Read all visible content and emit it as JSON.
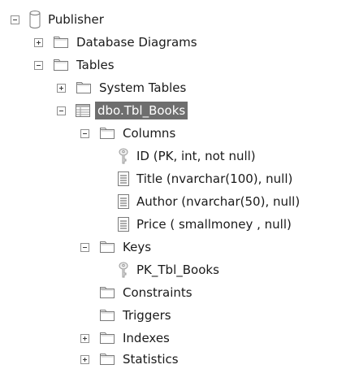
{
  "tree": {
    "root": "Publisher",
    "database_diagrams": "Database Diagrams",
    "tables": "Tables",
    "system_tables": "System Tables",
    "selected_table": "dbo.Tbl_Books",
    "columns": "Columns",
    "col_id": "ID (PK, int, not null)",
    "col_title": "Title (nvarchar(100), null)",
    "col_author": "Author (nvarchar(50), null)",
    "col_price": "Price ( smallmoney , null)",
    "keys": "Keys",
    "pk": "PK_Tbl_Books",
    "constraints": "Constraints",
    "triggers": "Triggers",
    "indexes": "Indexes",
    "statistics": "Statistics"
  }
}
